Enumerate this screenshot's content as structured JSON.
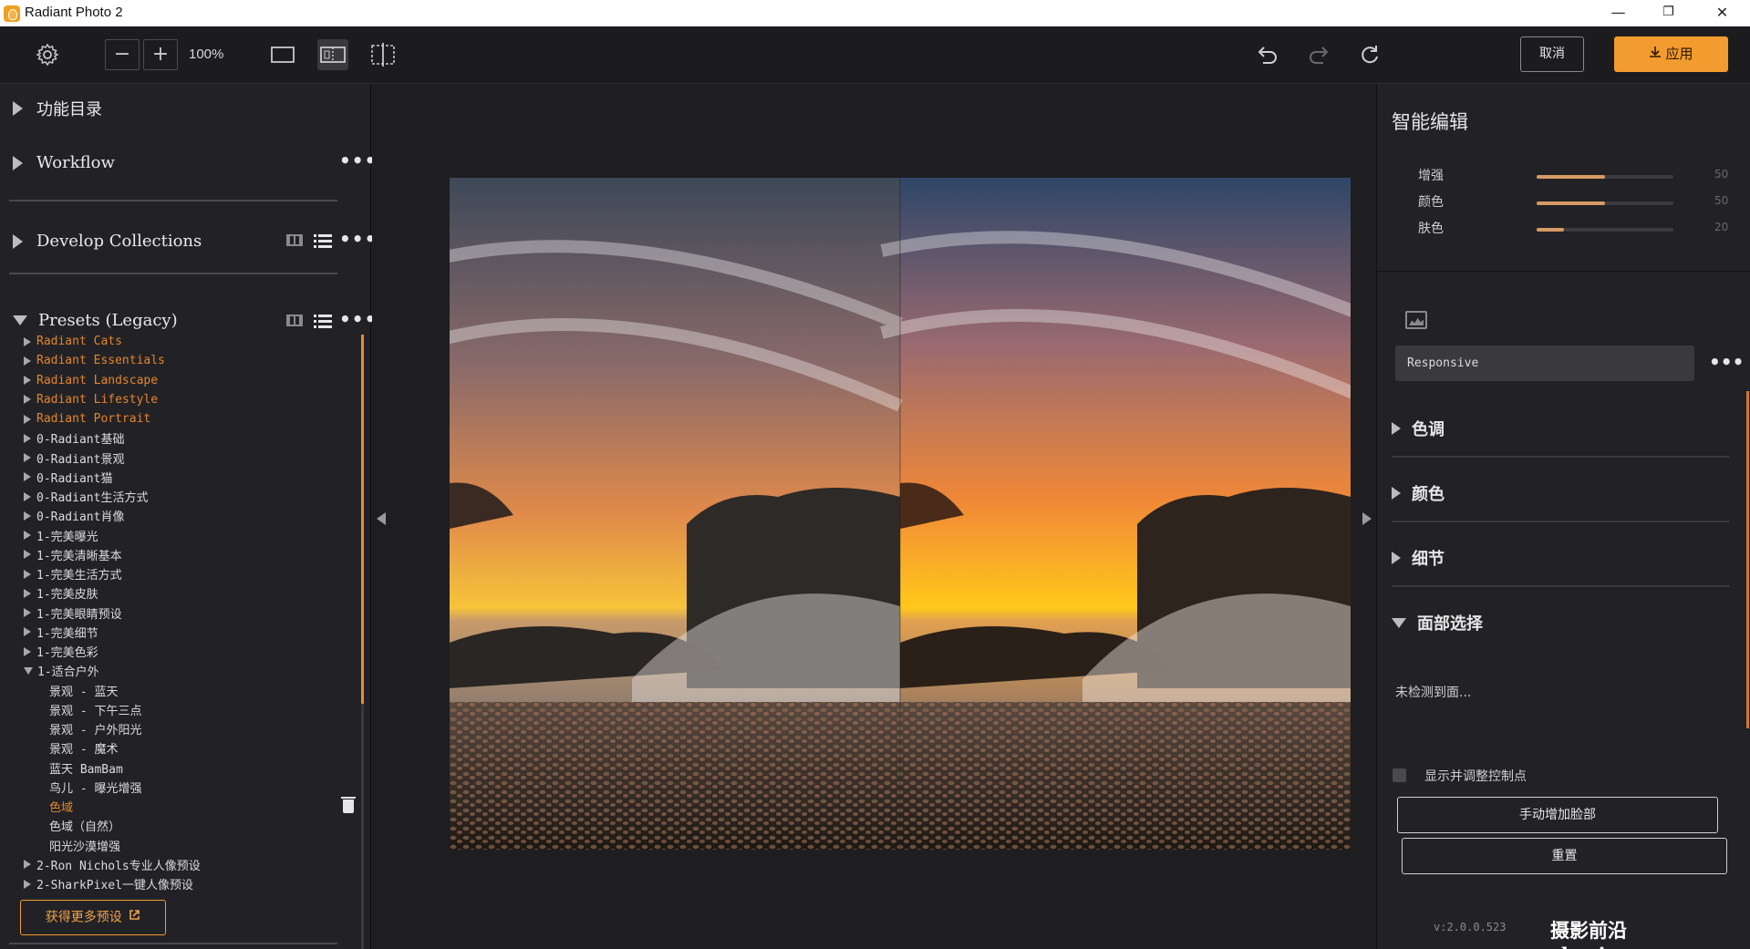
{
  "window": {
    "title": "Radiant Photo 2",
    "minimize": "—",
    "maximize": "❐",
    "close": "✕"
  },
  "toolbar": {
    "zoom_out": "−",
    "zoom_in": "+",
    "zoom_value": "100%",
    "cancel_label": "取消",
    "apply_label": "应用"
  },
  "left": {
    "function_dir": "功能目录",
    "workflow": "Workflow",
    "develop_collections": "Develop Collections",
    "presets_legacy": "Presets (Legacy)",
    "presets": [
      {
        "label": "Radiant Cats",
        "orange": true,
        "open": false,
        "child": false
      },
      {
        "label": "Radiant Essentials",
        "orange": true,
        "open": false,
        "child": false
      },
      {
        "label": "Radiant Landscape",
        "orange": true,
        "open": false,
        "child": false
      },
      {
        "label": "Radiant Lifestyle",
        "orange": true,
        "open": false,
        "child": false
      },
      {
        "label": "Radiant Portrait",
        "orange": true,
        "open": false,
        "child": false
      },
      {
        "label": "0-Radiant基础",
        "orange": false,
        "open": false,
        "child": false
      },
      {
        "label": "0-Radiant景观",
        "orange": false,
        "open": false,
        "child": false
      },
      {
        "label": "0-Radiant猫",
        "orange": false,
        "open": false,
        "child": false
      },
      {
        "label": "0-Radiant生活方式",
        "orange": false,
        "open": false,
        "child": false
      },
      {
        "label": "0-Radiant肖像",
        "orange": false,
        "open": false,
        "child": false
      },
      {
        "label": "1-完美曝光",
        "orange": false,
        "open": false,
        "child": false
      },
      {
        "label": "1-完美清晰基本",
        "orange": false,
        "open": false,
        "child": false
      },
      {
        "label": "1-完美生活方式",
        "orange": false,
        "open": false,
        "child": false
      },
      {
        "label": "1-完美皮肤",
        "orange": false,
        "open": false,
        "child": false
      },
      {
        "label": "1-完美眼睛预设",
        "orange": false,
        "open": false,
        "child": false
      },
      {
        "label": "1-完美细节",
        "orange": false,
        "open": false,
        "child": false
      },
      {
        "label": "1-完美色彩",
        "orange": false,
        "open": false,
        "child": false
      },
      {
        "label": "1-适合户外",
        "orange": false,
        "open": true,
        "child": false
      },
      {
        "label": "景观 - 蓝天",
        "orange": false,
        "open": false,
        "child": true
      },
      {
        "label": "景观 - 下午三点",
        "orange": false,
        "open": false,
        "child": true
      },
      {
        "label": "景观 - 户外阳光",
        "orange": false,
        "open": false,
        "child": true
      },
      {
        "label": "景观 - 魔术",
        "orange": false,
        "open": false,
        "child": true
      },
      {
        "label": "蓝天 BamBam",
        "orange": false,
        "open": false,
        "child": true
      },
      {
        "label": "鸟儿 - 曝光增强",
        "orange": false,
        "open": false,
        "child": true
      },
      {
        "label": "色域",
        "orange": true,
        "open": false,
        "child": true
      },
      {
        "label": "色域（自然）",
        "orange": false,
        "open": false,
        "child": true
      },
      {
        "label": "阳光沙漠增强",
        "orange": false,
        "open": false,
        "child": true
      },
      {
        "label": "2-Ron Nichols专业人像预设",
        "orange": false,
        "open": false,
        "child": false
      },
      {
        "label": "2-SharkPixel一键人像预设",
        "orange": false,
        "open": false,
        "child": false
      }
    ],
    "more_presets": "获得更多预设"
  },
  "right": {
    "title": "智能编辑",
    "sliders": [
      {
        "label": "增强",
        "value": 50,
        "max": 100
      },
      {
        "label": "颜色",
        "value": 50,
        "max": 100
      },
      {
        "label": "肤色",
        "value": 20,
        "max": 100
      }
    ],
    "mode_select": "Responsive",
    "sections": [
      "色调",
      "颜色",
      "细节",
      "面部选择"
    ],
    "face_status": "未检测到面...",
    "show_points_label": "显示并调整控制点",
    "add_face_button": "手动增加脸部",
    "reset_button": "重置",
    "version": "v:2.0.0.523"
  },
  "watermark": "摄影前沿 sheyingzyz.com",
  "colors": {
    "accent": "#f29b2e",
    "preset_orange": "#e3852d",
    "panel": "#222226"
  }
}
